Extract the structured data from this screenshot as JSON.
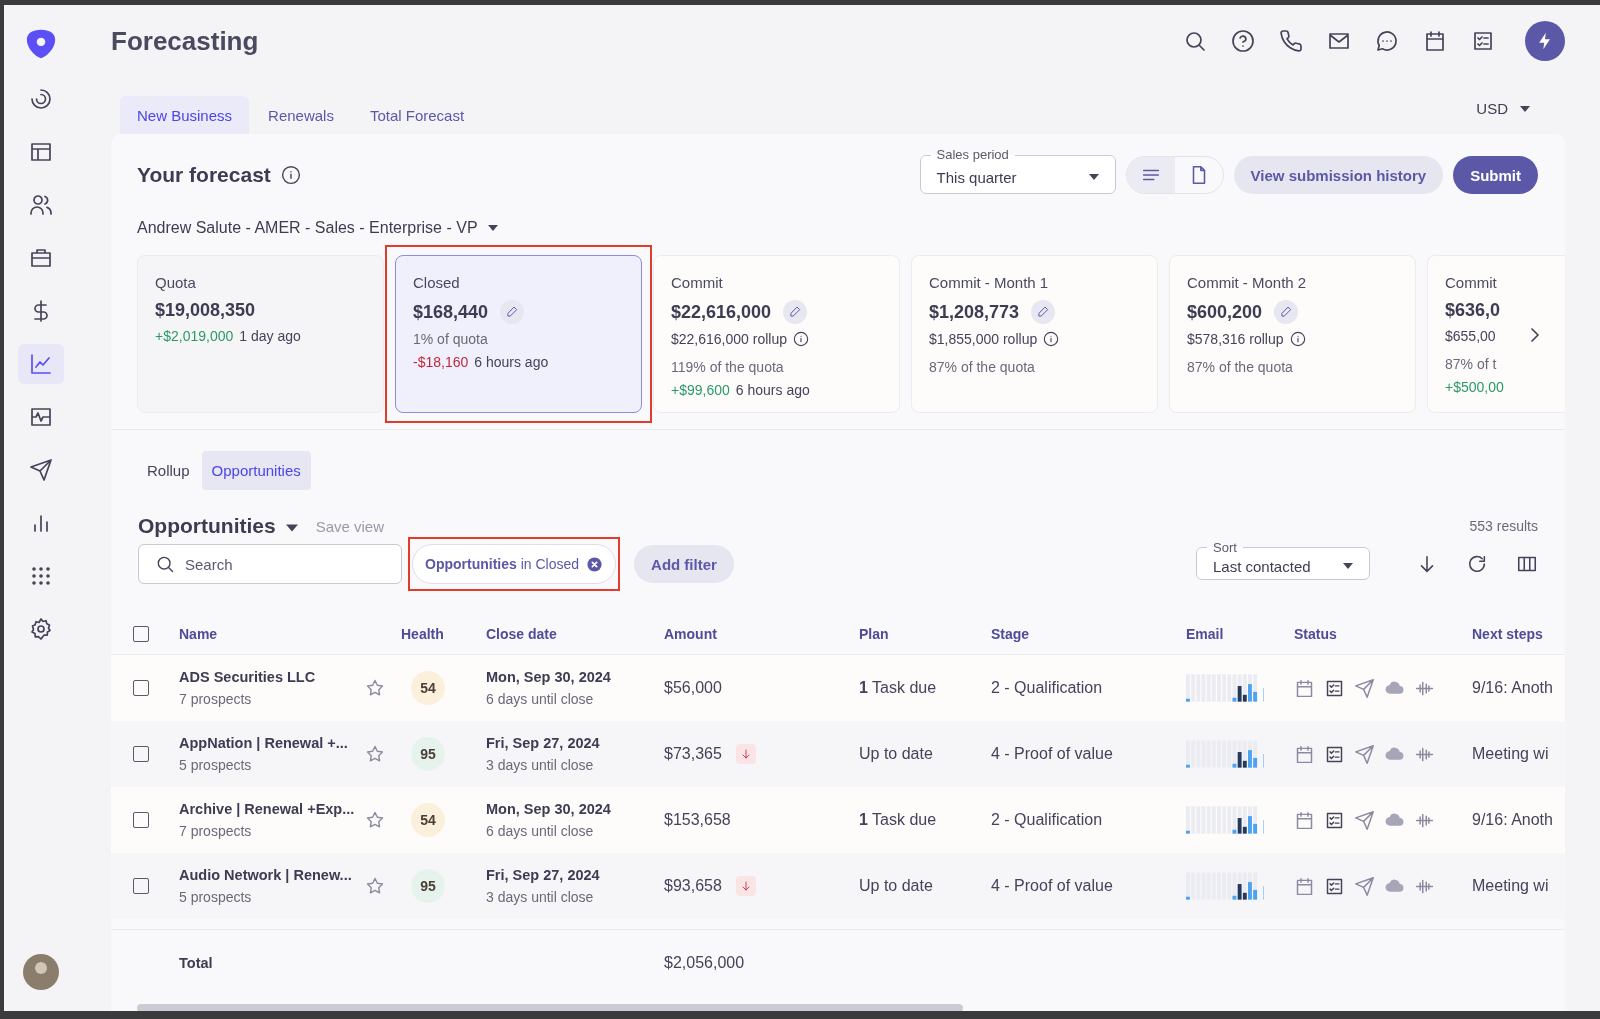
{
  "app": {
    "title": "Forecasting"
  },
  "sidebar": {
    "items": [
      {
        "kind": "gauge",
        "selected": false
      },
      {
        "kind": "layout",
        "selected": false
      },
      {
        "kind": "people",
        "selected": false
      },
      {
        "kind": "briefcase",
        "selected": false
      },
      {
        "kind": "dollar",
        "selected": false
      },
      {
        "kind": "chart",
        "selected": true
      },
      {
        "kind": "pulse",
        "selected": false
      },
      {
        "kind": "send",
        "selected": false
      },
      {
        "kind": "bars",
        "selected": false
      },
      {
        "kind": "grid",
        "selected": false
      },
      {
        "kind": "settings",
        "selected": false
      }
    ]
  },
  "tabs": [
    {
      "label": "New Business",
      "selected": true
    },
    {
      "label": "Renewals",
      "selected": false
    },
    {
      "label": "Total Forecast",
      "selected": false
    }
  ],
  "currency": "USD",
  "forecast": {
    "title": "Your forecast",
    "sales_period": {
      "label": "Sales period",
      "value": "This quarter"
    },
    "history_button": "View submission history",
    "submit_button": "Submit",
    "owner": "Andrew Salute - AMER - Sales - Enterprise - VP",
    "cards": [
      {
        "label": "Quota",
        "value": "$19,008,350",
        "kind": "quota",
        "selected": false,
        "highlighted": false,
        "editable": false,
        "delta": {
          "amount": "+$2,019,000",
          "color": "#2b9a66",
          "time": "1 day ago"
        }
      },
      {
        "label": "Closed",
        "value": "$168,440",
        "kind": "forecast",
        "selected": true,
        "highlighted": true,
        "editable": true,
        "note": "1% of quota",
        "delta": {
          "amount": "-$18,160",
          "color": "#c0283e",
          "time": "6 hours ago"
        }
      },
      {
        "label": "Commit",
        "value": "$22,616,000",
        "kind": "forecast",
        "selected": false,
        "highlighted": false,
        "editable": true,
        "rollup": "$22,616,000 rollup",
        "rollup_info": true,
        "note": "119% of the quota",
        "delta": {
          "amount": "+$99,600",
          "color": "#2b9a66",
          "time": "6 hours ago"
        }
      },
      {
        "label": "Commit - Month 1",
        "value": "$1,208,773",
        "kind": "forecast",
        "selected": false,
        "highlighted": false,
        "editable": true,
        "rollup": "$1,855,000 rollup",
        "rollup_info": true,
        "note": "87% of the quota"
      },
      {
        "label": "Commit - Month 2",
        "value": "$600,200",
        "kind": "forecast",
        "selected": false,
        "highlighted": false,
        "editable": true,
        "rollup": "$578,316 rollup",
        "rollup_info": true,
        "note": "87% of the quota"
      },
      {
        "label": "Commit",
        "value": "$636,0",
        "kind": "forecast",
        "selected": false,
        "highlighted": false,
        "editable": false,
        "rollup": "$655,00",
        "rollup_info": false,
        "note": "87% of t",
        "delta": {
          "amount": "+$500,00",
          "color": "#2b9a66"
        }
      }
    ]
  },
  "subtabs": [
    {
      "label": "Rollup",
      "selected": false
    },
    {
      "label": "Opportunities",
      "selected": true
    }
  ],
  "opportunities": {
    "title": "Opportunities",
    "save_view": "Save view",
    "results": "553 results",
    "search": {
      "placeholder": "Search"
    },
    "filter": {
      "text": "**Opportunities** in Closed",
      "highlighted": true
    },
    "add_filter": "Add filter",
    "sort": {
      "label": "Sort",
      "value": "Last contacted"
    }
  },
  "table": {
    "select_all": {
      "checked": false
    },
    "columns": [
      "Name",
      "Health",
      "Close date",
      "Amount",
      "Plan",
      "Stage",
      "Email",
      "Status",
      "Next steps"
    ],
    "rows": [
      {
        "name": "ADS Securities LLC",
        "prospects": "7 prospects",
        "selected": false,
        "starred": false,
        "health": {
          "score": "54",
          "color": "#fbf0dc"
        },
        "close_date": "Mon, Sep 30, 2024",
        "until": "6 days until close",
        "amount": "$56,000",
        "amount_down": false,
        "plan": "**1** Task due",
        "stage": "2 - Qualification",
        "next_steps": "9/16: Anoth"
      },
      {
        "name": "AppNation | Renewal +...",
        "prospects": "5 prospects",
        "selected": false,
        "starred": false,
        "health": {
          "score": "95",
          "color": "#e6f3ec"
        },
        "close_date": "Fri, Sep 27, 2024",
        "until": "3 days until close",
        "amount": "$73,365",
        "amount_down": true,
        "plan": "Up to date",
        "stage": "4 - Proof of value",
        "next_steps": "Meeting wi"
      },
      {
        "name": "Archive | Renewal +Exp...",
        "prospects": "7 prospects",
        "selected": false,
        "starred": false,
        "health": {
          "score": "54",
          "color": "#fbf0dc"
        },
        "close_date": "Mon, Sep 30, 2024",
        "until": "6 days until close",
        "amount": "$153,658",
        "amount_down": false,
        "plan": "**1** Task due",
        "stage": "2 - Qualification",
        "next_steps": "9/16: Anoth"
      },
      {
        "name": "Audio Network | Renew...",
        "prospects": "5 prospects",
        "selected": false,
        "starred": false,
        "health": {
          "score": "95",
          "color": "#e6f3ec"
        },
        "close_date": "Fri, Sep 27, 2024",
        "until": "3 days until close",
        "amount": "$93,658",
        "amount_down": true,
        "plan": "Up to date",
        "stage": "4 - Proof of value",
        "next_steps": "Meeting wi"
      }
    ],
    "total": {
      "label": "Total",
      "amount": "$2,056,000"
    }
  }
}
